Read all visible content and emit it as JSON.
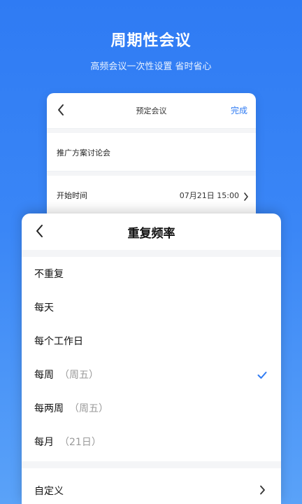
{
  "hero": {
    "title": "周期性会议",
    "subtitle": "高频会议一次性设置 省时省心"
  },
  "booking": {
    "title": "预定会议",
    "done_label": "完成",
    "meeting_name": "推广方案讨论会",
    "start_label": "开始时间",
    "start_value": "07月21日 15:00"
  },
  "repeat": {
    "title": "重复频率",
    "options": [
      {
        "label": "不重复",
        "hint": "",
        "selected": false
      },
      {
        "label": "每天",
        "hint": "",
        "selected": false
      },
      {
        "label": "每个工作日",
        "hint": "",
        "selected": false
      },
      {
        "label": "每周",
        "hint": "（周五）",
        "selected": true
      },
      {
        "label": "每两周",
        "hint": "（周五）",
        "selected": false
      },
      {
        "label": "每月",
        "hint": "（21日）",
        "selected": false
      }
    ],
    "custom_label": "自定义"
  },
  "colors": {
    "accent": "#2f7bf3",
    "background_top": "#2f7bf3",
    "background_bottom": "#5aa2f8"
  },
  "icons": {
    "back": "chevron-left-icon",
    "forward": "chevron-right-icon",
    "selected": "checkmark-icon"
  }
}
